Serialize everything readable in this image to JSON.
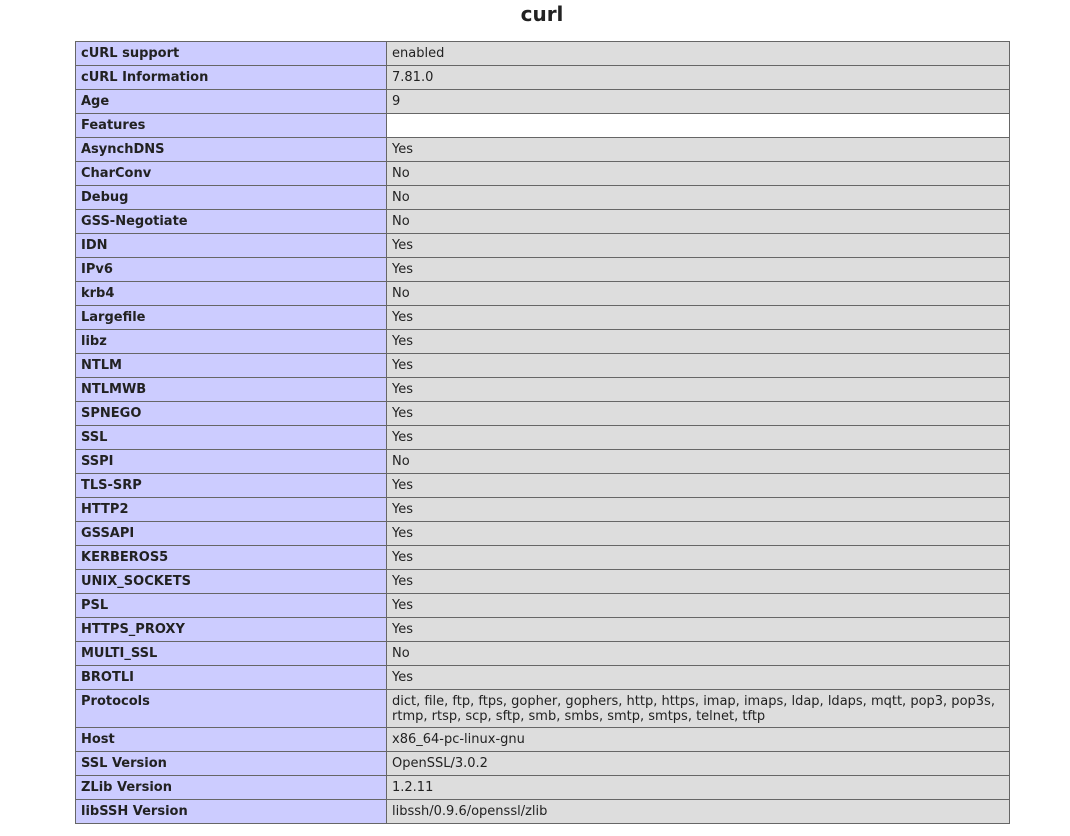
{
  "title": "curl",
  "rows": [
    {
      "key": "cURL support",
      "value": "enabled"
    },
    {
      "key": "cURL Information",
      "value": "7.81.0"
    },
    {
      "key": "Age",
      "value": "9"
    },
    {
      "key": "Features",
      "value": ""
    },
    {
      "key": "AsynchDNS",
      "value": "Yes"
    },
    {
      "key": "CharConv",
      "value": "No"
    },
    {
      "key": "Debug",
      "value": "No"
    },
    {
      "key": "GSS-Negotiate",
      "value": "No"
    },
    {
      "key": "IDN",
      "value": "Yes"
    },
    {
      "key": "IPv6",
      "value": "Yes"
    },
    {
      "key": "krb4",
      "value": "No"
    },
    {
      "key": "Largefile",
      "value": "Yes"
    },
    {
      "key": "libz",
      "value": "Yes"
    },
    {
      "key": "NTLM",
      "value": "Yes"
    },
    {
      "key": "NTLMWB",
      "value": "Yes"
    },
    {
      "key": "SPNEGO",
      "value": "Yes"
    },
    {
      "key": "SSL",
      "value": "Yes"
    },
    {
      "key": "SSPI",
      "value": "No"
    },
    {
      "key": "TLS-SRP",
      "value": "Yes"
    },
    {
      "key": "HTTP2",
      "value": "Yes"
    },
    {
      "key": "GSSAPI",
      "value": "Yes"
    },
    {
      "key": "KERBEROS5",
      "value": "Yes"
    },
    {
      "key": "UNIX_SOCKETS",
      "value": "Yes"
    },
    {
      "key": "PSL",
      "value": "Yes"
    },
    {
      "key": "HTTPS_PROXY",
      "value": "Yes"
    },
    {
      "key": "MULTI_SSL",
      "value": "No"
    },
    {
      "key": "BROTLI",
      "value": "Yes"
    },
    {
      "key": "Protocols",
      "value": "dict, file, ftp, ftps, gopher, gophers, http, https, imap, imaps, ldap, ldaps, mqtt, pop3, pop3s, rtmp, rtsp, scp, sftp, smb, smbs, smtp, smtps, telnet, tftp"
    },
    {
      "key": "Host",
      "value": "x86_64-pc-linux-gnu"
    },
    {
      "key": "SSL Version",
      "value": "OpenSSL/3.0.2"
    },
    {
      "key": "ZLib Version",
      "value": "1.2.11"
    },
    {
      "key": "libSSH Version",
      "value": "libssh/0.9.6/openssl/zlib"
    }
  ]
}
